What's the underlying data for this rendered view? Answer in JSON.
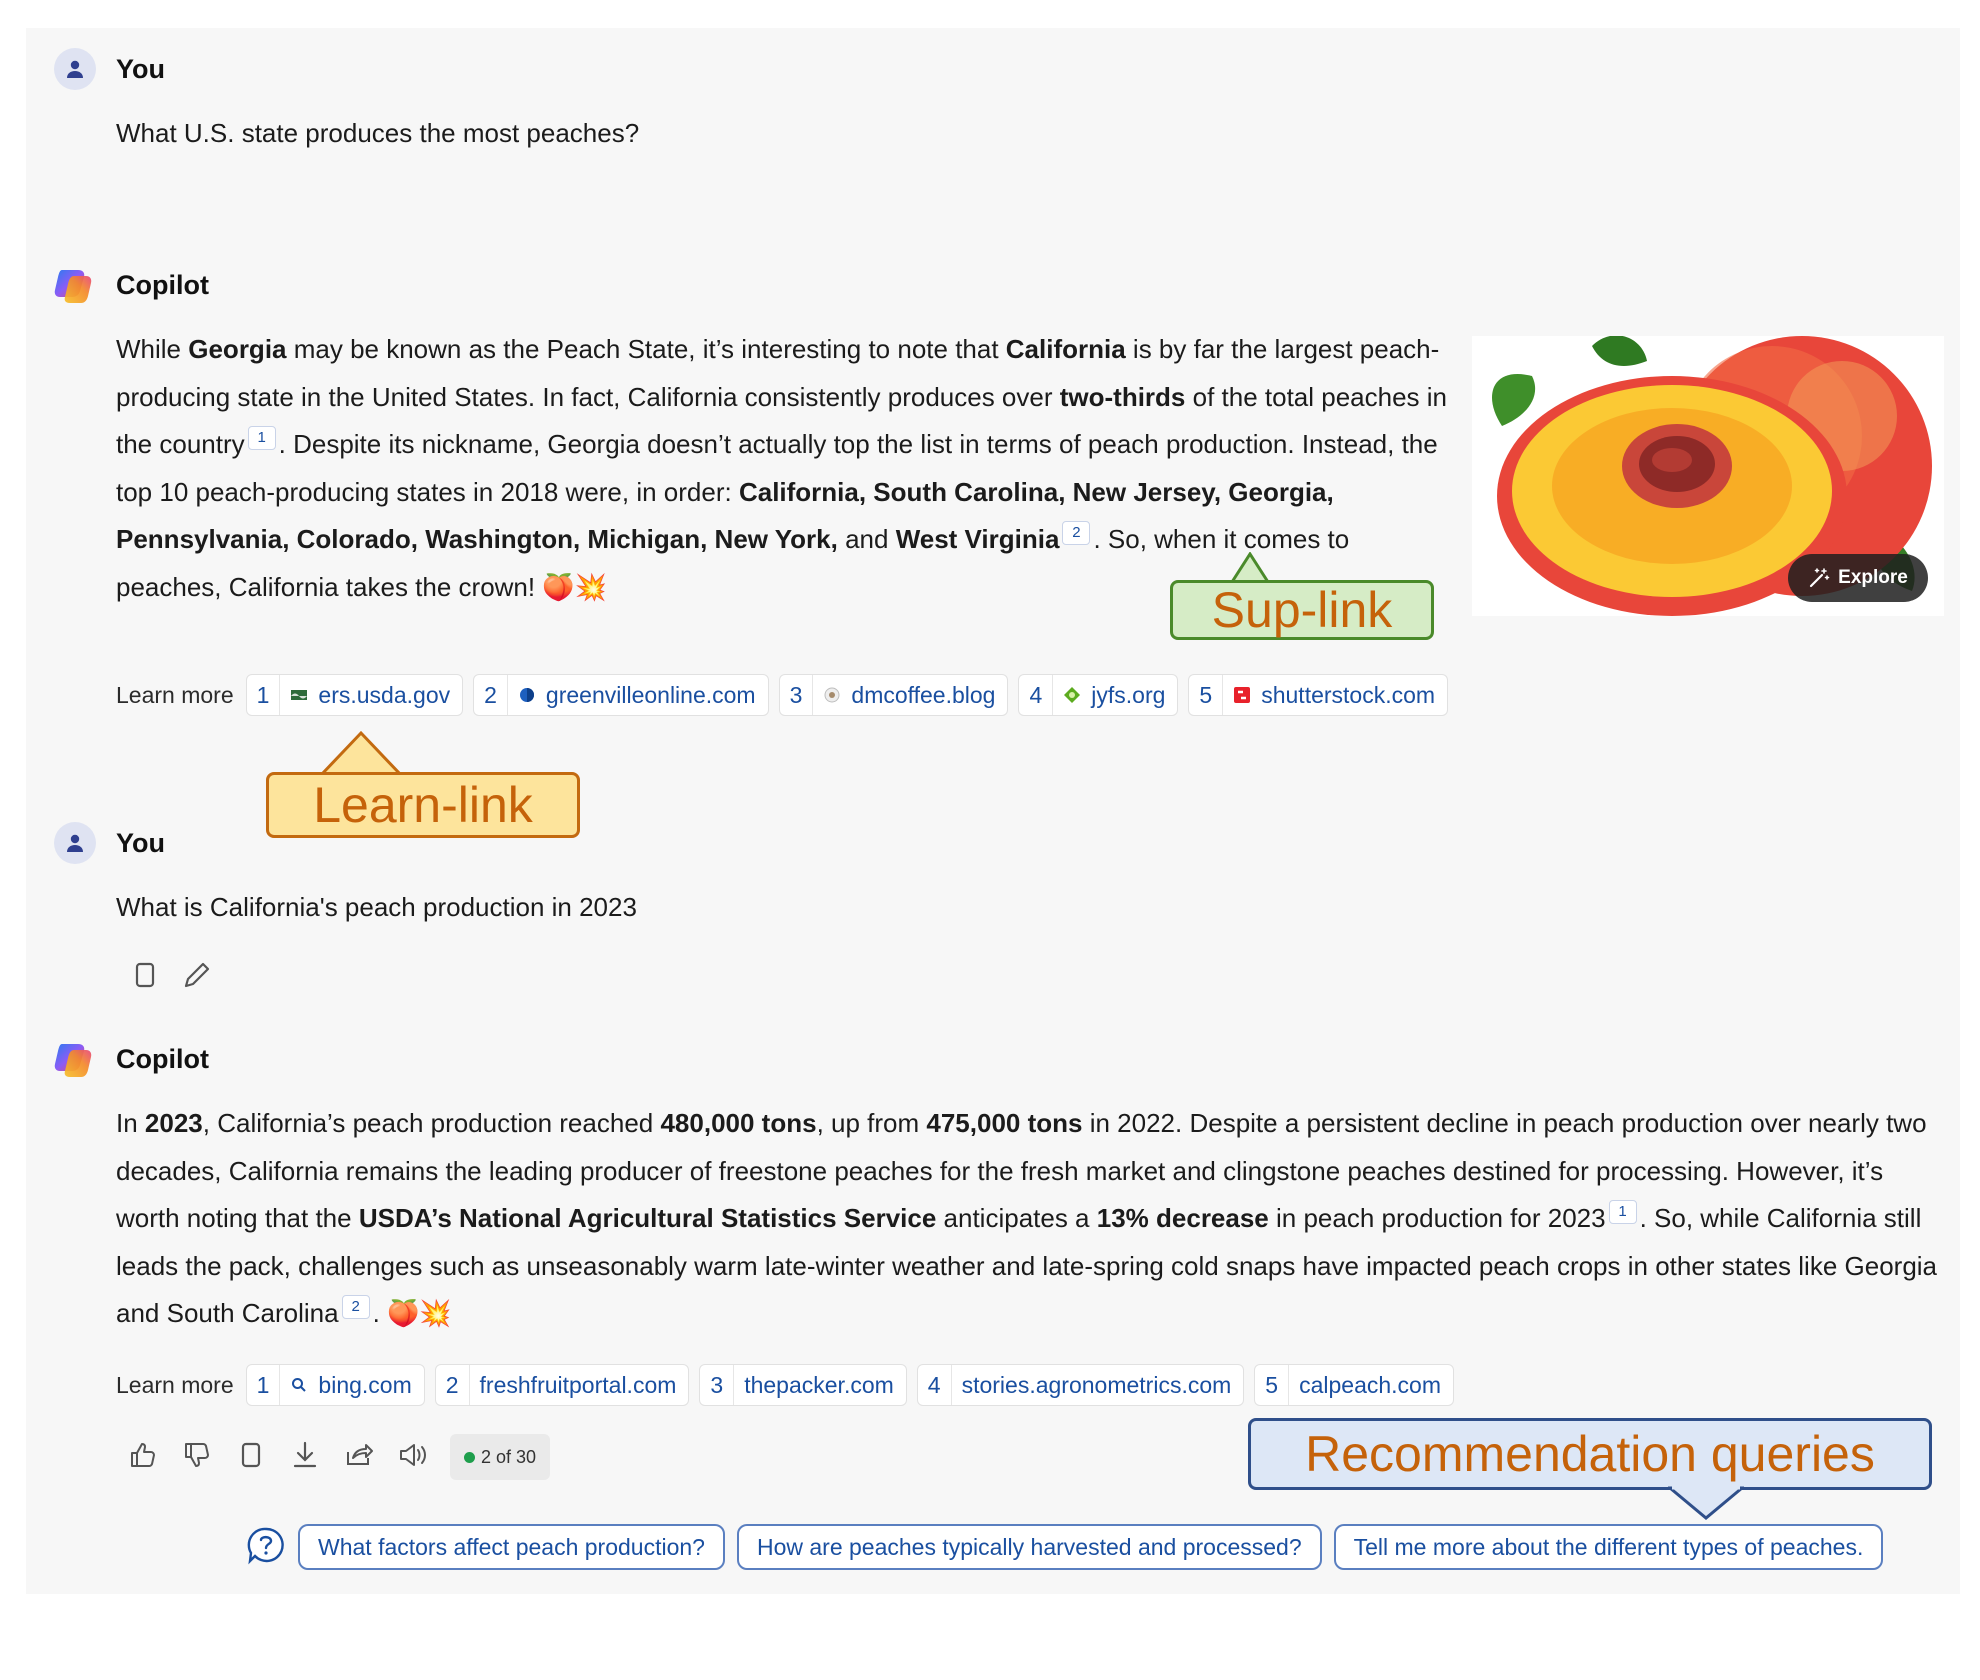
{
  "turn1": {
    "user_label": "You",
    "user_message": "What U.S. state produces the most peaches?",
    "assistant_label": "Copilot",
    "answer": {
      "p1a": "While ",
      "b1": "Georgia",
      "p1b": " may be known as the Peach State, it’s interesting to note that ",
      "b2": "California",
      "p1c": " is by far the largest peach-producing state in the United States. In fact, California consistently produces over ",
      "b3": "two-thirds",
      "p1d": " of the total peaches in the country",
      "sup1": "1",
      "p1e": ". Despite its nickname, Georgia doesn’t actually top the list in terms of peach production. Instead, the top 10 peach-producing states in 2018 were, in order: ",
      "b4": "California, South Carolina, New Jersey, Georgia, Pennsylvania, Colorado, Washington, Michigan, New York,",
      "p1f": " and ",
      "b5": "West Virginia",
      "sup2": "2",
      "p1g": ". So, when it comes to peaches, California takes the crown! 🍑💥"
    },
    "image_explore_label": "Explore",
    "learn_more_label": "Learn more",
    "learn_links": [
      {
        "num": "1",
        "domain": "ers.usda.gov"
      },
      {
        "num": "2",
        "domain": "greenvilleonline.com"
      },
      {
        "num": "3",
        "domain": "dmcoffee.blog"
      },
      {
        "num": "4",
        "domain": "jyfs.org"
      },
      {
        "num": "5",
        "domain": "shutterstock.com"
      }
    ]
  },
  "turn2": {
    "user_label": "You",
    "user_message": "What is California's peach production in 2023",
    "assistant_label": "Copilot",
    "answer": {
      "p1": "In ",
      "b1": "2023",
      "p2": ", California’s peach production reached ",
      "b2": "480,000 tons",
      "p3": ", up from ",
      "b3": "475,000 tons",
      "p4": " in 2022. Despite a persistent decline in peach production over nearly two decades, California remains the leading producer of freestone peaches for the fresh market and clingstone peaches destined for processing. However, it’s worth noting that the ",
      "b4": "USDA’s National Agricultural Statistics Service",
      "p5": " anticipates a ",
      "b5": "13% decrease",
      "p6": " in peach production for 2023",
      "sup1": "1",
      "p7": ". So, while California still leads the pack, challenges such as unseasonably warm late-winter weather and late-spring cold snaps have impacted peach crops in other states like Georgia and South Carolina",
      "sup2": "2",
      "p8": ". 🍑💥"
    },
    "learn_more_label": "Learn more",
    "learn_links": [
      {
        "num": "1",
        "domain": "bing.com"
      },
      {
        "num": "2",
        "domain": "freshfruitportal.com"
      },
      {
        "num": "3",
        "domain": "thepacker.com"
      },
      {
        "num": "4",
        "domain": "stories.agronometrics.com"
      },
      {
        "num": "5",
        "domain": "calpeach.com"
      }
    ],
    "response_counter": "2 of 30"
  },
  "suggestions": [
    "What factors affect peach production?",
    "How are peaches typically harvested and processed?",
    "Tell me more about the different types of peaches."
  ],
  "annotations": {
    "sup_link": "Sup-link",
    "learn_link": "Learn-link",
    "recommendation": "Recommendation queries"
  },
  "colors": {
    "link": "#1a4fa0",
    "panel_bg": "#f7f7f7",
    "callout_green": "#d6ecc6",
    "callout_yellow": "#fde49c",
    "callout_blue": "#dde7f6",
    "callout_text": "#c5620a"
  }
}
